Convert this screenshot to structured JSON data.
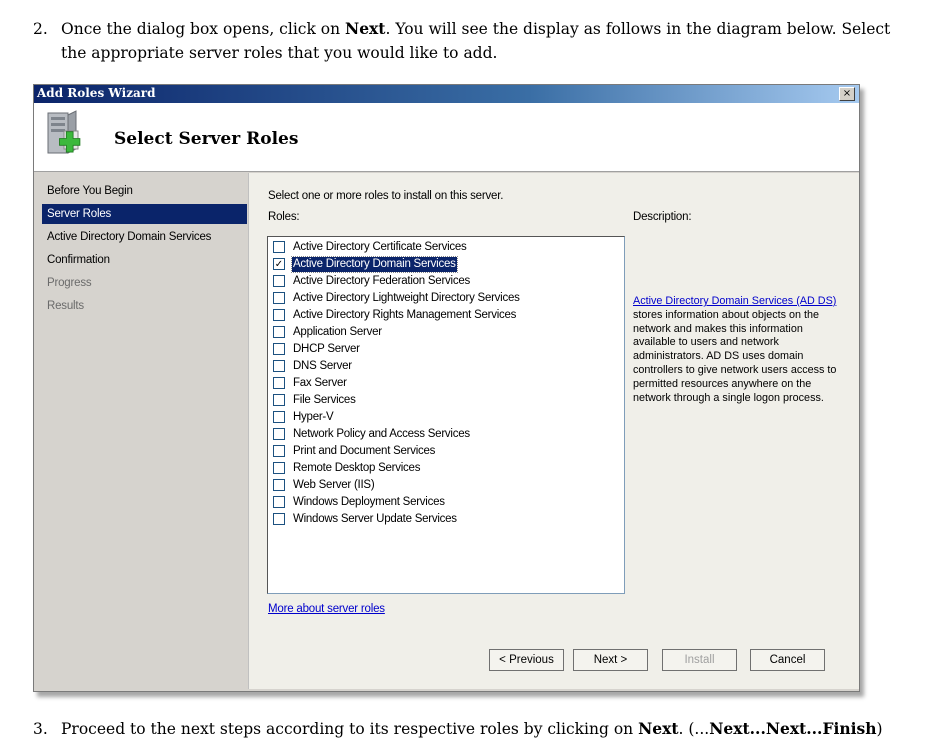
{
  "step2": {
    "number": "2.",
    "pre": "Once the dialog box opens, click on ",
    "bold": "Next",
    "post1": ". You will see the display as follows in the diagram below. Select",
    "line2": "the appropriate server roles that you would like to add."
  },
  "step3": {
    "number": "3.",
    "pre": "Proceed to the next steps according to its respective roles by clicking on ",
    "bold1": "Next",
    "mid": ". (...",
    "bold2": "Next...Next...Finish",
    "post": ")"
  },
  "dialog": {
    "title": "Add Roles Wizard",
    "close_glyph": "×",
    "heading": "Select Server Roles",
    "nav": [
      {
        "label": "Before You Begin",
        "state": "normal"
      },
      {
        "label": "Server Roles",
        "state": "selected"
      },
      {
        "label": "Active Directory Domain Services",
        "state": "normal"
      },
      {
        "label": "Confirmation",
        "state": "normal"
      },
      {
        "label": "Progress",
        "state": "disabled"
      },
      {
        "label": "Results",
        "state": "disabled"
      }
    ],
    "instruction": "Select one or more roles to install on this server.",
    "roles_label": "Roles:",
    "roles": [
      {
        "label": "Active Directory Certificate Services",
        "checked": false,
        "selected": false
      },
      {
        "label": "Active Directory Domain Services",
        "checked": true,
        "selected": true
      },
      {
        "label": "Active Directory Federation Services",
        "checked": false,
        "selected": false
      },
      {
        "label": "Active Directory Lightweight Directory Services",
        "checked": false,
        "selected": false
      },
      {
        "label": "Active Directory Rights Management Services",
        "checked": false,
        "selected": false
      },
      {
        "label": "Application Server",
        "checked": false,
        "selected": false
      },
      {
        "label": "DHCP Server",
        "checked": false,
        "selected": false
      },
      {
        "label": "DNS Server",
        "checked": false,
        "selected": false
      },
      {
        "label": "Fax Server",
        "checked": false,
        "selected": false
      },
      {
        "label": "File Services",
        "checked": false,
        "selected": false
      },
      {
        "label": "Hyper-V",
        "checked": false,
        "selected": false
      },
      {
        "label": "Network Policy and Access Services",
        "checked": false,
        "selected": false
      },
      {
        "label": "Print and Document Services",
        "checked": false,
        "selected": false
      },
      {
        "label": "Remote Desktop Services",
        "checked": false,
        "selected": false
      },
      {
        "label": "Web Server (IIS)",
        "checked": false,
        "selected": false
      },
      {
        "label": "Windows Deployment Services",
        "checked": false,
        "selected": false
      },
      {
        "label": "Windows Server Update Services",
        "checked": false,
        "selected": false
      }
    ],
    "check_glyph": "✓",
    "description_label": "Description:",
    "description_link": "Active Directory Domain Services (AD DS)",
    "description_text": " stores information about objects on the network and makes this information available to users and network administrators. AD DS uses domain controllers to give network users access to permitted resources anywhere on the network through a single logon process.",
    "more_link": "More about server roles",
    "buttons": {
      "previous": "< Previous",
      "next": "Next >",
      "install": "Install",
      "cancel": "Cancel"
    },
    "colors": {
      "selection": "#0a246a",
      "link": "#0000cc",
      "icon_plus": "#3cb83c"
    }
  }
}
